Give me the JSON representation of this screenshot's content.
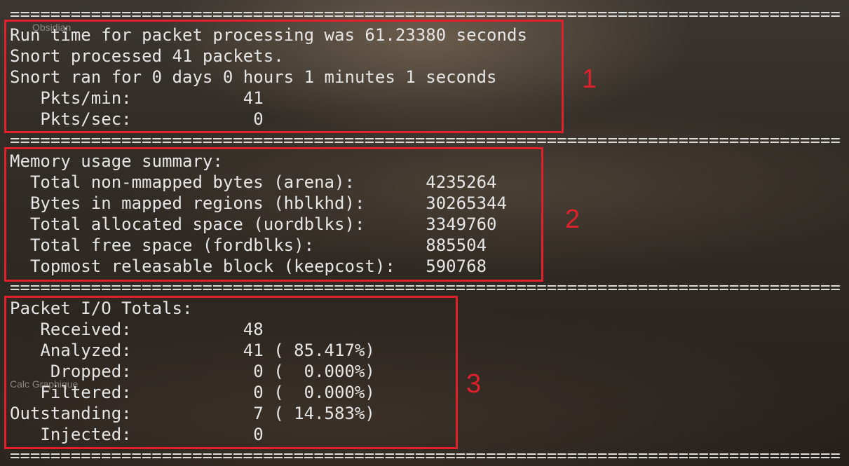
{
  "desktop": {
    "icon_label_1": "Obsidian",
    "icon_label_2": "Calc Graphique"
  },
  "separator": "=========================================================================================================",
  "runtime": {
    "line1": "Run time for packet processing was 61.23380 seconds",
    "line2": "Snort processed 41 packets.",
    "line3": "Snort ran for 0 days 0 hours 1 minutes 1 seconds",
    "line4": "   Pkts/min:           41",
    "line5": "   Pkts/sec:            0"
  },
  "memory": {
    "header": "Memory usage summary:",
    "rows": [
      "  Total non-mmapped bytes (arena):       4235264",
      "  Bytes in mapped regions (hblkhd):      30265344",
      "  Total allocated space (uordblks):      3349760",
      "  Total free space (fordblks):           885504",
      "  Topmost releasable block (keepcost):   590768"
    ]
  },
  "packet_io": {
    "header": "Packet I/O Totals:",
    "rows": [
      "   Received:           48",
      "   Analyzed:           41 ( 85.417%)",
      "    Dropped:            0 (  0.000%)",
      "   Filtered:            0 (  0.000%)",
      "Outstanding:            7 ( 14.583%)",
      "   Injected:            0"
    ]
  },
  "annotations": {
    "box1": "1",
    "box2": "2",
    "box3": "3"
  }
}
